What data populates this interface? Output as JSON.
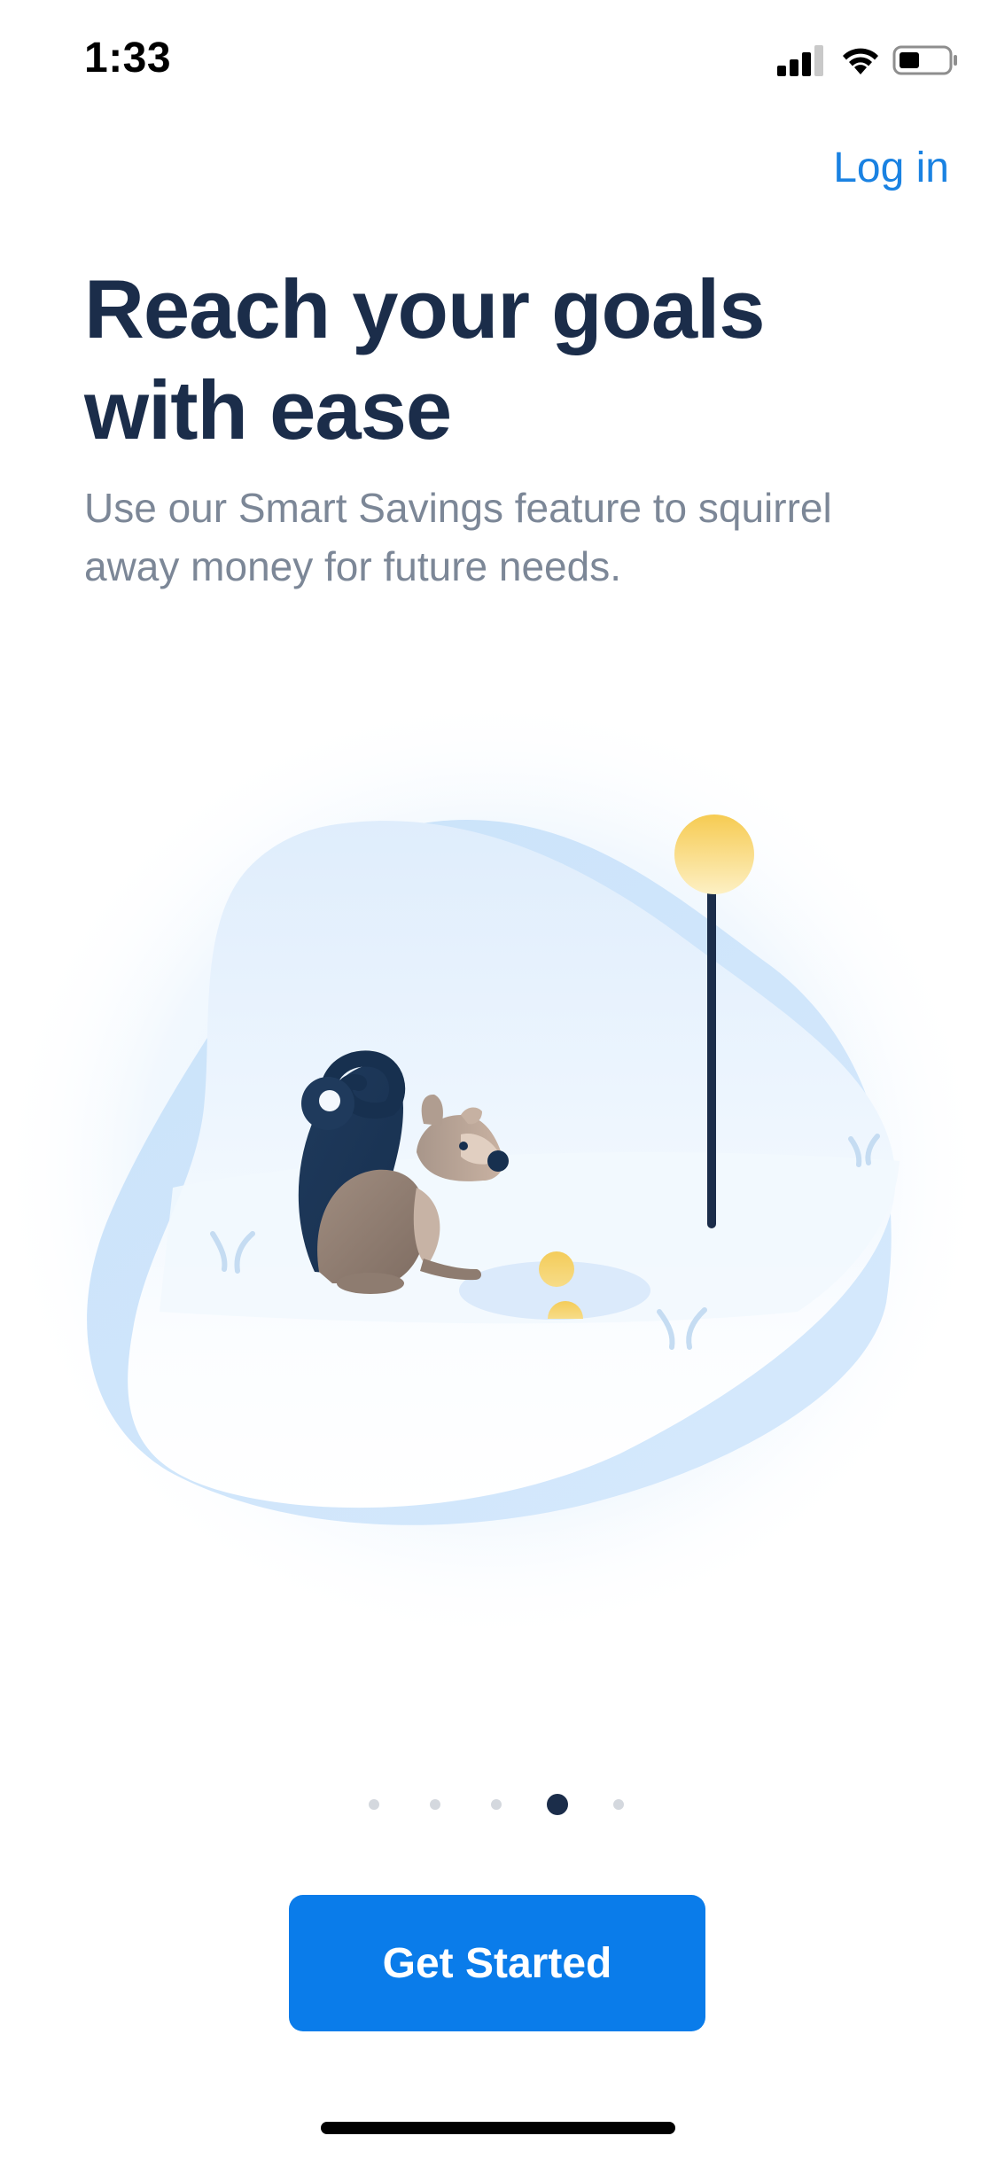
{
  "status_bar": {
    "time": "1:33"
  },
  "header": {
    "login_label": "Log in"
  },
  "onboarding": {
    "title": "Reach your goals with ease",
    "subtitle": "Use our Smart Savings feature to squirrel away money for future needs.",
    "illustration_icon": "squirrel-icon"
  },
  "pager": {
    "total_pages": 5,
    "current_page": 4
  },
  "cta": {
    "label": "Get Started"
  },
  "colors": {
    "accent": "#0a7cea",
    "link": "#1a82e2",
    "heading": "#1b2d4a",
    "body_text": "#7c8797",
    "dot_inactive": "#d4d8de",
    "coin": "#f4cc5a"
  }
}
